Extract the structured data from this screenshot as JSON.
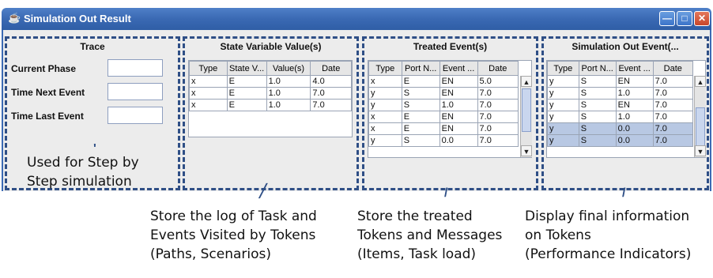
{
  "window": {
    "title": "Simulation Out Result",
    "icon": "java-cup-icon"
  },
  "trace": {
    "title": "Trace",
    "fields": [
      {
        "label": "Current Phase",
        "value": ""
      },
      {
        "label": "Time Next Event",
        "value": ""
      },
      {
        "label": "Time Last Event",
        "value": ""
      }
    ]
  },
  "state_variables": {
    "title": "State Variable Value(s)",
    "columns": [
      "Type",
      "State V...",
      "Value(s)",
      "Date"
    ],
    "rows": [
      [
        "x",
        "E",
        "1.0",
        "4.0"
      ],
      [
        "x",
        "E",
        "1.0",
        "7.0"
      ],
      [
        "x",
        "E",
        "1.0",
        "7.0"
      ]
    ]
  },
  "treated_events": {
    "title": "Treated Event(s)",
    "columns": [
      "Type",
      "Port N...",
      "Event ...",
      "Date"
    ],
    "rows": [
      [
        "x",
        "E",
        "EN",
        "5.0"
      ],
      [
        "y",
        "S",
        "EN",
        "7.0"
      ],
      [
        "y",
        "S",
        "1.0",
        "7.0"
      ],
      [
        "x",
        "E",
        "EN",
        "7.0"
      ],
      [
        "x",
        "E",
        "EN",
        "7.0"
      ],
      [
        "y",
        "S",
        "0.0",
        "7.0"
      ]
    ]
  },
  "simulation_out_events": {
    "title": "Simulation Out Event(...",
    "columns": [
      "Type",
      "Port N...",
      "Event ...",
      "Date"
    ],
    "rows": [
      [
        "y",
        "S",
        "EN",
        "7.0"
      ],
      [
        "y",
        "S",
        "1.0",
        "7.0"
      ],
      [
        "y",
        "S",
        "EN",
        "7.0"
      ],
      [
        "y",
        "S",
        "1.0",
        "7.0"
      ],
      [
        "y",
        "S",
        "0.0",
        "7.0"
      ],
      [
        "y",
        "S",
        "0.0",
        "7.0"
      ]
    ],
    "selected_rows": [
      4,
      5
    ]
  },
  "captions": {
    "trace": [
      "Used for Step by",
      "Step simulation"
    ],
    "state_variables": [
      "Store the log of Task and",
      "Events Visited by Tokens",
      "(Paths, Scenarios)"
    ],
    "treated_events": [
      "Store the treated",
      "Tokens and Messages",
      "(Items, Task load)"
    ],
    "simulation_out_events": [
      "Display final information",
      "on Tokens",
      "(Performance Indicators)"
    ]
  },
  "colors": {
    "titlebar": "#3a69b3",
    "dashed_border": "#2f4f86",
    "selection": "#b8c8e3",
    "close_button": "#c8462a"
  }
}
